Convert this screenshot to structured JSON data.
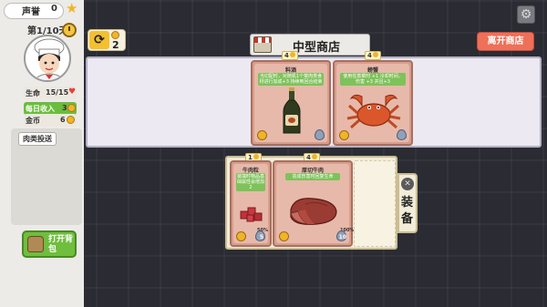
{
  "status": {
    "score_label": "声誉",
    "score_value": "0",
    "day_label": "第1/10天",
    "life_label": "生命",
    "life_value": "15/15",
    "income_label": "每日收入",
    "income_value": "3",
    "gold_label": "金币",
    "gold_value": "6",
    "skill_tag": "肉类投送",
    "bag_label": "打开背包"
  },
  "shop": {
    "title": "中型商店",
    "refresh_cost": "2",
    "leave_label": "离开商店",
    "items": [
      {
        "name": "料酒",
        "price": "4",
        "desc": "当切配时，对随机1个菜肉类食材进行加成+3 持续到回合结束"
      },
      {
        "name": "螃蟹",
        "price": "4",
        "desc": "使用任意菜时 +1 冷却时间，伤害 +3 并且+3"
      }
    ]
  },
  "equipment": {
    "tab_label": "装备",
    "items": [
      {
        "name": "牛肉粒",
        "price": "1",
        "desc": "装填时物品基础属性会增加2",
        "quality": "50%",
        "slot_num": "5"
      },
      {
        "name": "厚切牛肉",
        "price": "4",
        "desc": "造成伤害时回复生命",
        "quality": "100%",
        "slot_num": "10"
      }
    ]
  },
  "colors": {
    "accent_green": "#6fbe3e",
    "leave_red": "#ef7059",
    "card_pink": "#e7b9aa",
    "coin_gold": "#f0b428"
  },
  "icons": [
    "star-icon",
    "clock-icon",
    "heart-icon",
    "coin-icon",
    "refresh-icon",
    "shop-stall-icon",
    "gear-icon",
    "bag-icon",
    "wine-bottle-icon",
    "crab-icon",
    "beef-cubes-icon",
    "steak-icon",
    "water-drop-icon",
    "tools-icon"
  ]
}
